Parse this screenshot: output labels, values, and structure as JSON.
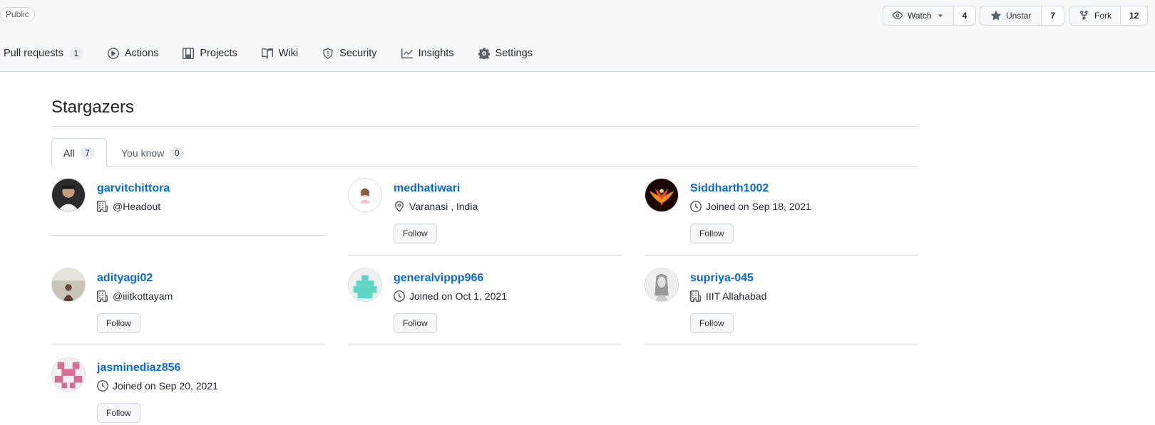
{
  "repo": {
    "visibility_badge": "Public"
  },
  "actions": {
    "watch": {
      "label": "Watch",
      "count": "4"
    },
    "star": {
      "label": "Unstar",
      "count": "7"
    },
    "fork": {
      "label": "Fork",
      "count": "12"
    }
  },
  "nav": {
    "pull_requests": {
      "label": "Pull requests",
      "count": "1"
    },
    "actions": {
      "label": "Actions"
    },
    "projects": {
      "label": "Projects"
    },
    "wiki": {
      "label": "Wiki"
    },
    "security": {
      "label": "Security"
    },
    "insights": {
      "label": "Insights"
    },
    "settings": {
      "label": "Settings"
    }
  },
  "page": {
    "title": "Stargazers"
  },
  "tabs": [
    {
      "label": "All",
      "count": "7"
    },
    {
      "label": "You know",
      "count": "0"
    }
  ],
  "follow_label": "Follow",
  "users": [
    {
      "username": "garvitchittora",
      "meta_icon": "organization-icon",
      "meta": "@Headout"
    },
    {
      "username": "medhatiwari",
      "meta_icon": "location-icon",
      "meta": " Varanasi , India"
    },
    {
      "username": "Siddharth1002",
      "meta_icon": "clock-icon",
      "meta": "Joined on Sep 18, 2021"
    },
    {
      "username": "adityagi02",
      "meta_icon": "organization-icon",
      "meta": "@iiitkottayam"
    },
    {
      "username": "generalvippp966",
      "meta_icon": "clock-icon",
      "meta": "Joined on Oct 1, 2021"
    },
    {
      "username": "supriya-045",
      "meta_icon": "organization-icon",
      "meta": "IIIT Allahabad"
    },
    {
      "username": "jasminediaz856",
      "meta_icon": "clock-icon",
      "meta": "Joined on Sep 20, 2021"
    }
  ]
}
